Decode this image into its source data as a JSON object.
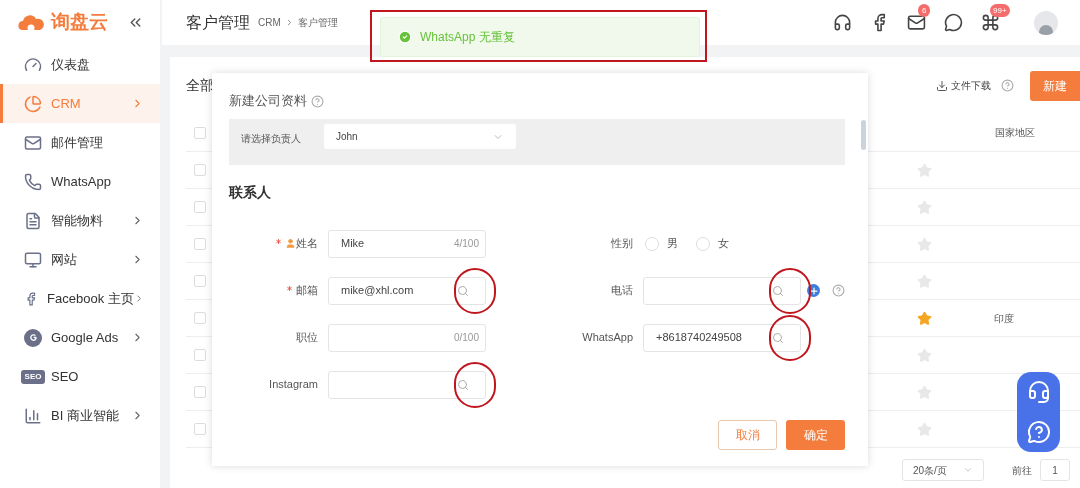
{
  "brand": {
    "name": "询盘云"
  },
  "sidebar": {
    "items": [
      {
        "label": "仪表盘",
        "selected": false,
        "has_submenu": false
      },
      {
        "label": "CRM",
        "selected": true,
        "has_submenu": true
      },
      {
        "label": "邮件管理",
        "selected": false,
        "has_submenu": false
      },
      {
        "label": "WhatsApp",
        "selected": false,
        "has_submenu": false
      },
      {
        "label": "智能物料",
        "selected": false,
        "has_submenu": true
      },
      {
        "label": "网站",
        "selected": false,
        "has_submenu": true
      },
      {
        "label": "Facebook 主页",
        "selected": false,
        "has_submenu": true
      },
      {
        "label": "Google Ads",
        "selected": false,
        "has_submenu": true
      },
      {
        "label": "SEO",
        "selected": false,
        "has_submenu": false,
        "icon_text": "SEO"
      },
      {
        "label": "BI 商业智能",
        "selected": false,
        "has_submenu": true
      }
    ]
  },
  "header": {
    "title": "客户管理",
    "breadcrumb": [
      "CRM",
      "客户管理"
    ],
    "mail_badge": "6",
    "apps_badge": "99+"
  },
  "toast": {
    "message": "WhatsApp 无重复",
    "framed": true
  },
  "list": {
    "filter": "全部",
    "download": "文件下载",
    "new_button": "新建",
    "column_header": "国家地区",
    "all_checked": false,
    "rows": [
      {
        "checked": false,
        "starred": false
      },
      {
        "checked": false,
        "starred": false
      },
      {
        "checked": false,
        "starred": false
      },
      {
        "checked": false,
        "starred": false
      },
      {
        "checked": false,
        "starred": true,
        "country": "印度"
      },
      {
        "checked": false,
        "starred": false
      },
      {
        "checked": false,
        "starred": false
      },
      {
        "checked": false,
        "starred": false
      }
    ],
    "pagination": {
      "page_size": "20条/页",
      "goto": "前往",
      "page": "1"
    }
  },
  "dialog": {
    "title": "新建公司资料",
    "owner_label": "请选择负责人",
    "owner_value": "John",
    "section": "联系人",
    "left_fields": [
      {
        "kind": "text",
        "label": "姓名",
        "required": true,
        "person_icon": true,
        "value": "Mike",
        "counter": "4/100"
      },
      {
        "kind": "search",
        "label": "邮箱",
        "required": true,
        "value": "mike@xhl.com",
        "circled": true
      },
      {
        "kind": "text",
        "label": "职位",
        "required": false,
        "counter": "0/100"
      },
      {
        "kind": "search",
        "label": "Instagram",
        "required": false,
        "circled": true
      }
    ],
    "right_fields": [
      {
        "kind": "radio",
        "label": "性别",
        "options": [
          {
            "label": "男",
            "selected": false
          },
          {
            "label": "女",
            "selected": false
          }
        ]
      },
      {
        "kind": "search",
        "label": "电话",
        "required": false,
        "circled": true,
        "extras": true
      },
      {
        "kind": "search",
        "label": "WhatsApp",
        "required": false,
        "value": "+8618740249508",
        "circled": true
      }
    ],
    "buttons": [
      {
        "label": "取消",
        "kind": "secondary"
      },
      {
        "label": "确定",
        "kind": "primary"
      }
    ]
  }
}
